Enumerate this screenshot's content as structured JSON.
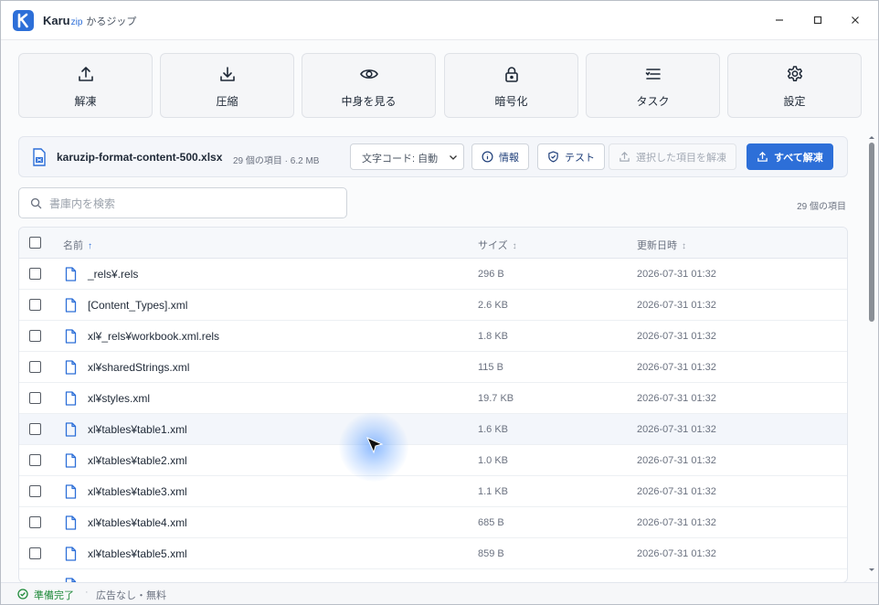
{
  "app": {
    "name": "Karu",
    "name_suffix": "zip",
    "subtitle": "かるジップ",
    "brand_color": "#2d6fd8"
  },
  "window_controls": {
    "minimize_icon": "minimize-icon",
    "maximize_icon": "maximize-icon",
    "close_icon": "close-icon"
  },
  "toolbar": {
    "items": [
      {
        "label": "解凍",
        "icon": "upload-icon"
      },
      {
        "label": "圧縮",
        "icon": "download-icon"
      },
      {
        "label": "中身を見る",
        "icon": "eye-icon"
      },
      {
        "label": "暗号化",
        "icon": "lock-icon"
      },
      {
        "label": "タスク",
        "icon": "list-icon"
      },
      {
        "label": "設定",
        "icon": "gear-icon"
      }
    ]
  },
  "archive": {
    "name": "karuzip-format-content-500.xlsx",
    "meta": "29 個の項目 · 6.2 MB",
    "encoding_value": "文字コード: 自動",
    "info_button": "情報",
    "test_button": "テスト",
    "extract_selected_button": "選択した項目を解凍",
    "extract_all_button": "すべて解凍"
  },
  "search": {
    "placeholder": "書庫内を検索",
    "value": ""
  },
  "item_count": "29 個の項目",
  "table": {
    "headers": {
      "name": "名前",
      "name_sort": "↑",
      "size": "サイズ",
      "size_sort": "↕",
      "date": "更新日時",
      "date_sort": "↕"
    },
    "rows": [
      {
        "name": "_rels¥.rels",
        "size": "296 B",
        "date": "2026-07-31 01:32"
      },
      {
        "name": "[Content_Types].xml",
        "size": "2.6 KB",
        "date": "2026-07-31 01:32"
      },
      {
        "name": "xl¥_rels¥workbook.xml.rels",
        "size": "1.8 KB",
        "date": "2026-07-31 01:32"
      },
      {
        "name": "xl¥sharedStrings.xml",
        "size": "115 B",
        "date": "2026-07-31 01:32"
      },
      {
        "name": "xl¥styles.xml",
        "size": "19.7 KB",
        "date": "2026-07-31 01:32"
      },
      {
        "name": "xl¥tables¥table1.xml",
        "size": "1.6 KB",
        "date": "2026-07-31 01:32"
      },
      {
        "name": "xl¥tables¥table2.xml",
        "size": "1.0 KB",
        "date": "2026-07-31 01:32"
      },
      {
        "name": "xl¥tables¥table3.xml",
        "size": "1.1 KB",
        "date": "2026-07-31 01:32"
      },
      {
        "name": "xl¥tables¥table4.xml",
        "size": "685 B",
        "date": "2026-07-31 01:32"
      },
      {
        "name": "xl¥tables¥table5.xml",
        "size": "859 B",
        "date": "2026-07-31 01:32"
      }
    ]
  },
  "status": {
    "ready": "準備完了",
    "separator": "·",
    "note": "広告なし・無料",
    "ok_color": "#1f8a3a"
  }
}
